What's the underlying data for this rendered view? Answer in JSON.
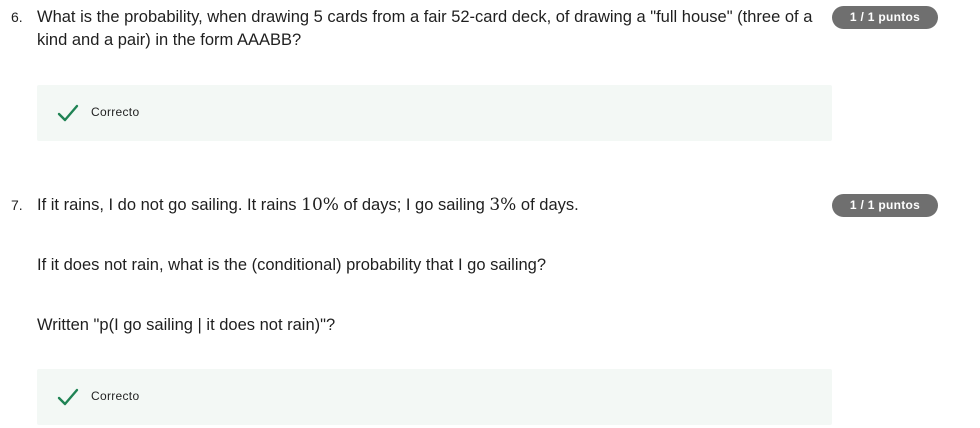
{
  "questions": [
    {
      "number": "6.",
      "text": "What is the probability, when drawing 5 cards from a fair 52-card deck, of drawing a \"full house\" (three of a kind and a pair) in the form AAABB?",
      "score": "1 / 1 puntos",
      "feedback": "Correcto"
    },
    {
      "number": "7.",
      "text_part1": "If it rains, I do not go sailing. It rains ",
      "math1": "10%",
      "text_part2": " of days; I go sailing ",
      "math2": "3%",
      "text_part3": " of days.",
      "para2": "If it does not rain, what is the (conditional) probability that I go sailing?",
      "para3": "Written \"p(I go sailing | it does not rain)\"?",
      "score": "1 / 1 puntos",
      "feedback": "Correcto"
    }
  ],
  "colors": {
    "badge_bg": "#6f6f6f",
    "feedback_bg": "#f3f8f5",
    "check": "#1f8354"
  },
  "icons": {
    "correct": "check-icon"
  }
}
